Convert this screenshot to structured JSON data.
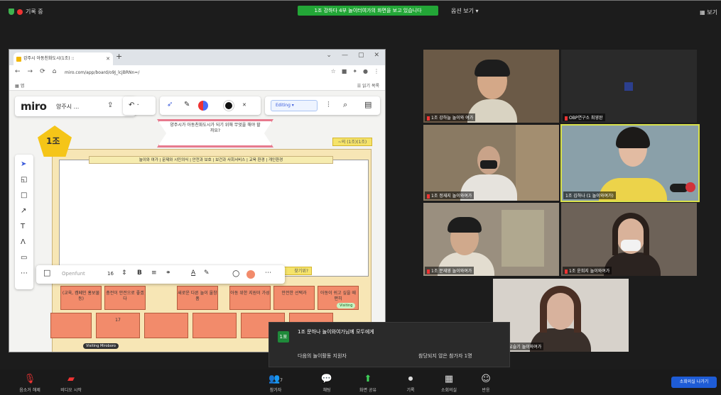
{
  "zoom": {
    "top_left_text": "기록 중",
    "share_banner": "1조 강하다 4부 놀이터여가의 화면을 보고 있습니다",
    "view_options": "옵션 보기 ▾",
    "top_right": "보기"
  },
  "browser": {
    "tab_title": "강주시 아동친화도시(1조) ::",
    "new_tab": "+",
    "url": "miro.com/app/board/o9J_lcjBRNn=/",
    "bookmark_left": "앱",
    "bookmark_right": "읽기 목록",
    "nav_icons": [
      "←",
      "→",
      "⟳",
      "⌂"
    ],
    "window_controls": [
      "⌄",
      "—",
      "▢",
      "✕"
    ]
  },
  "miro": {
    "logo": "miro",
    "board_name": "양주시 ...",
    "editing_label": "Editing ▾",
    "banner_text": "양주시가 아동친화도시가 되기 위해 무엇을 해야 할까요?",
    "team_label": "1조",
    "sticky_small": "~의 (1조)(1조)",
    "header_strip": "놀이와 여가 | 문제와 시민의식 | 안전과 보호 | 보건과 사회서비스 | 교육 환경 | 개인환경",
    "format_placeholder": "Openfunt",
    "format_size": "16",
    "sticky_wide": "찾기위?",
    "row1": [
      "(교육, 캠페인 홍보물 등)",
      "충전이 안전으로 좋겠다",
      "새로운 다른 놀이 울창품",
      "아동 위한 지원이 가성",
      "안전한 선택과",
      "아동이 쉬고 싶을 때 편히"
    ],
    "row2": [
      "",
      "17",
      "",
      "",
      "",
      ""
    ],
    "cursors": {
      "visiting": "Visiting Miroboro",
      "green": "Visiting"
    }
  },
  "videos": [
    {
      "name": "1조 강하늘 놀이와 여가"
    },
    {
      "name": "OBP연구소 최영완"
    },
    {
      "name": "1조 정재지 놀이와여가"
    },
    {
      "name": "1조 김하나 (1 놀이와여가)"
    },
    {
      "name": "1조 문재영 놀이와여가"
    },
    {
      "name": "1조 윤희지 놀이와여가"
    },
    {
      "name": "1조 유슬기 놀이와여가"
    }
  ],
  "notice": {
    "badge": "1포",
    "title": "1조 문하나 놀이와여가님께 모두에게",
    "left": "다음의 놀이활동 지원자",
    "right": "참당되지 않은 참가자 1명"
  },
  "bottom_bar": {
    "items": [
      {
        "icon": "🎤",
        "label": "음소거 해제",
        "name": "mute-button"
      },
      {
        "icon": "📹",
        "label": "비디오 시작",
        "name": "video-button"
      },
      {
        "icon": "👥",
        "label": "참가자",
        "name": "participants-button",
        "badge": "7"
      },
      {
        "icon": "💬",
        "label": "채팅",
        "name": "chat-button"
      },
      {
        "icon": "⬆",
        "label": "화면 공유",
        "name": "share-screen-button"
      },
      {
        "icon": "⏺",
        "label": "기록",
        "name": "record-button"
      },
      {
        "icon": "▦",
        "label": "소회의실",
        "name": "breakout-button"
      },
      {
        "icon": "☺",
        "label": "반응",
        "name": "reactions-button"
      }
    ],
    "end_label": "소회의실 나가기"
  }
}
